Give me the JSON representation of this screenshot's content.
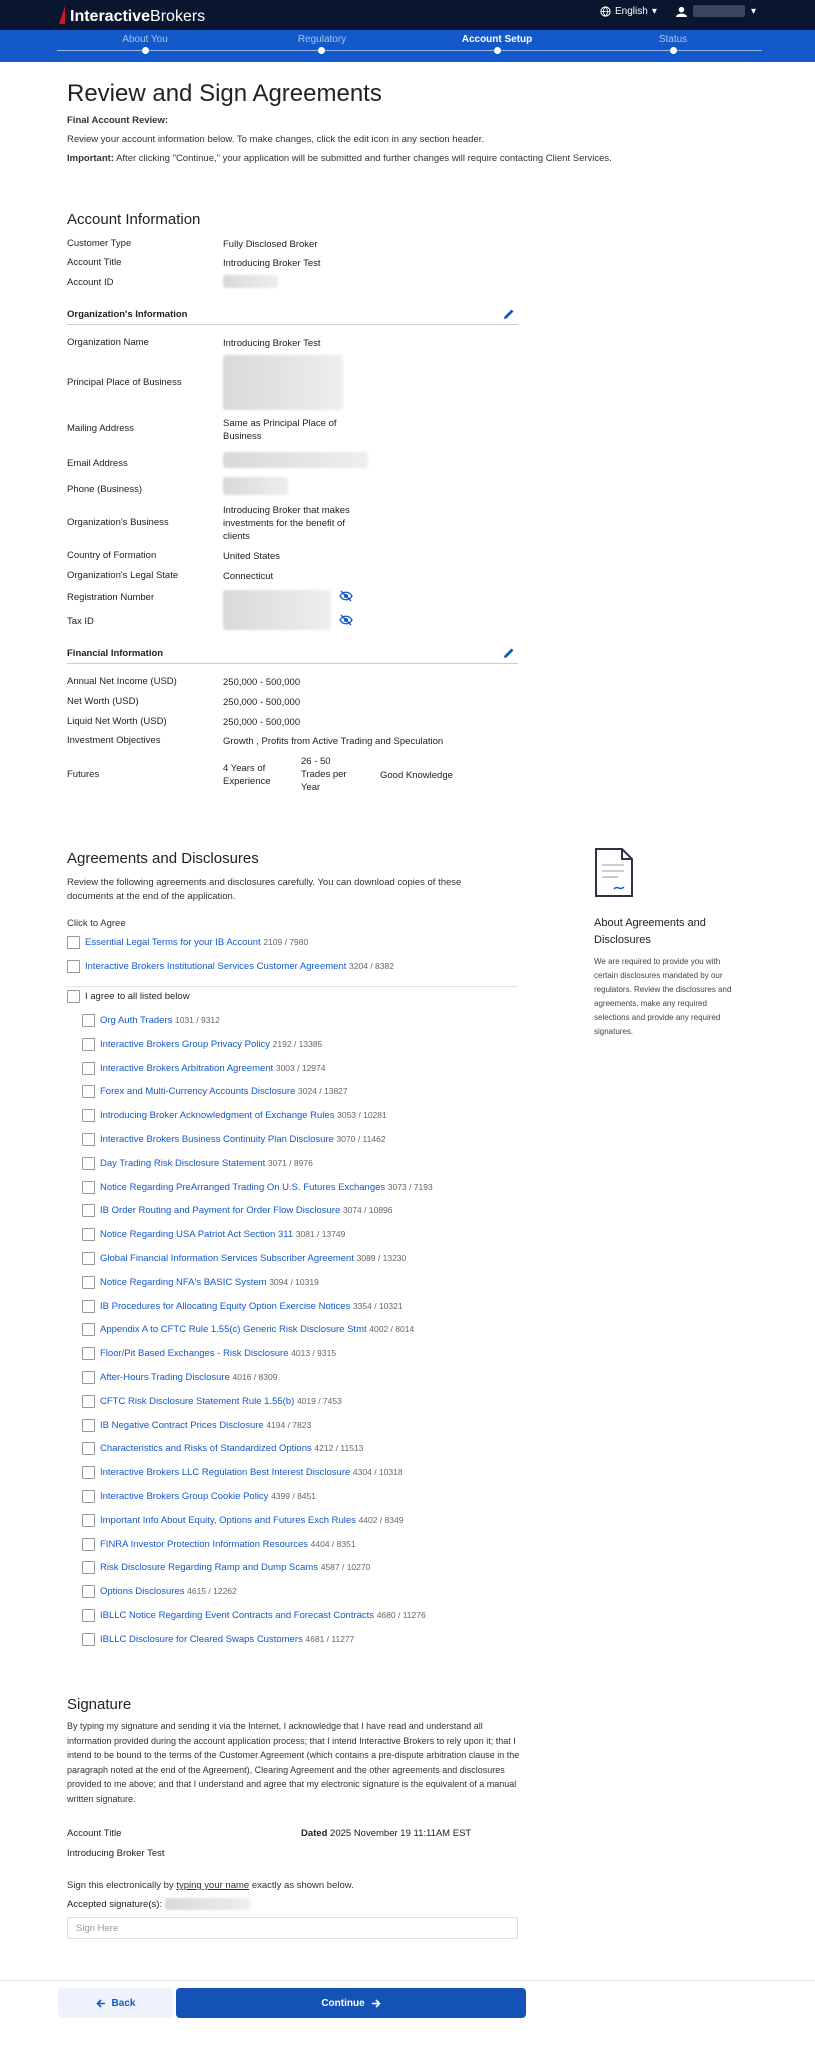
{
  "header": {
    "brand_bold": "Interactive",
    "brand_light": "Brokers",
    "language": "English",
    "language_caret": "▾",
    "user_caret": "▾"
  },
  "steps": [
    {
      "label": "About You",
      "active": false
    },
    {
      "label": "Regulatory",
      "active": false
    },
    {
      "label": "Account Setup",
      "active": true
    },
    {
      "label": "Status",
      "active": false
    }
  ],
  "page": {
    "title": "Review and Sign Agreements",
    "final_review": "Final Account Review:",
    "review_text": "Review your account information below. To make changes, click the edit icon in any section header.",
    "important_label": "Important:",
    "important_text": " After clicking \"Continue,\" your application will be submitted and further changes will require contacting Client Services."
  },
  "account_info": {
    "heading": "Account Information",
    "rows": [
      {
        "label": "Customer Type",
        "value": "Fully Disclosed Broker"
      },
      {
        "label": "Account Title",
        "value": "Introducing Broker Test"
      },
      {
        "label": "Account ID",
        "value": ""
      }
    ]
  },
  "org_info": {
    "heading": "Organization's Information",
    "rows": [
      {
        "label": "Organization Name",
        "value": "Introducing Broker Test"
      },
      {
        "label": "Principal Place of Business",
        "value": ""
      },
      {
        "label": "Mailing Address",
        "value": "Same as Principal Place of Business"
      },
      {
        "label": "Email Address",
        "value": ""
      },
      {
        "label": "Phone (Business)",
        "value": ""
      },
      {
        "label": "Organization's Business",
        "value": "Introducing Broker that makes investments for the benefit of clients"
      },
      {
        "label": "Country of Formation",
        "value": "United States"
      },
      {
        "label": "Organization's Legal State",
        "value": "Connecticut"
      },
      {
        "label": "Registration Number",
        "value": ""
      },
      {
        "label": "Tax ID",
        "value": ""
      }
    ]
  },
  "financial_info": {
    "heading": "Financial Information",
    "rows": [
      {
        "label": "Annual Net Income (USD)",
        "value": "250,000 - 500,000"
      },
      {
        "label": "Net Worth (USD)",
        "value": "250,000 - 500,000"
      },
      {
        "label": "Liquid Net Worth (USD)",
        "value": "250,000 - 500,000"
      },
      {
        "label": "Investment Objectives",
        "value": "Growth , Profits from Active Trading and Speculation"
      }
    ],
    "futures_label": "Futures",
    "futures_experience": "4 Years of Experience",
    "futures_trades": "26 - 50 Trades per Year",
    "futures_knowledge": "Good Knowledge"
  },
  "agreements": {
    "heading": "Agreements and Disclosures",
    "intro": "Review the following agreements and disclosures carefully. You can download copies of these documents at the end of the application.",
    "click_to_agree": "Click to Agree",
    "top_items": [
      {
        "title": "Essential Legal Terms for your IB Account",
        "ver": "2109 / 7980"
      },
      {
        "title": "Interactive Brokers Institutional Services Customer Agreement",
        "ver": "3204 / 8382"
      }
    ],
    "agree_all": "I agree to all listed below",
    "items": [
      {
        "title": "Org Auth Traders",
        "ver": "1031 / 9312"
      },
      {
        "title": "Interactive Brokers Group Privacy Policy",
        "ver": "2192 / 13385"
      },
      {
        "title": "Interactive Brokers Arbitration Agreement",
        "ver": "3003 / 12974"
      },
      {
        "title": "Forex and Multi-Currency Accounts Disclosure",
        "ver": "3024 / 13827"
      },
      {
        "title": "Introducing Broker Acknowledgment of Exchange Rules",
        "ver": "3053 / 10281"
      },
      {
        "title": "Interactive Brokers Business Continuity Plan Disclosure",
        "ver": "3070 / 11462"
      },
      {
        "title": "Day Trading Risk Disclosure Statement",
        "ver": "3071 / 8976"
      },
      {
        "title": "Notice Regarding PreArranged Trading On U.S. Futures  Exchanges",
        "ver": "3073 / 7193"
      },
      {
        "title": "IB Order Routing and Payment for Order Flow Disclosure",
        "ver": "3074 / 10896"
      },
      {
        "title": "Notice Regarding USA Patriot Act Section 311",
        "ver": "3081 / 13749"
      },
      {
        "title": "Global Financial Information Services Subscriber Agreement",
        "ver": "3089 / 13230"
      },
      {
        "title": "Notice Regarding NFA's BASIC System",
        "ver": "3094 / 10319"
      },
      {
        "title": "IB Procedures for Allocating Equity Option Exercise Notices",
        "ver": "3354 / 10321"
      },
      {
        "title": "Appendix A to CFTC Rule 1.55(c)  Generic Risk Disclosure Stmt",
        "ver": "4002 / 8014"
      },
      {
        "title": "Floor/Pit Based Exchanges - Risk Disclosure",
        "ver": "4013 / 9315"
      },
      {
        "title": "After-Hours Trading Disclosure",
        "ver": "4016 / 8309"
      },
      {
        "title": "CFTC Risk Disclosure Statement Rule 1.55(b)",
        "ver": "4019 / 7453"
      },
      {
        "title": "IB Negative Contract Prices Disclosure",
        "ver": "4194 / 7823"
      },
      {
        "title": "Characteristics and Risks of Standardized Options",
        "ver": "4212 / 11513"
      },
      {
        "title": "Interactive Brokers LLC Regulation Best Interest Disclosure",
        "ver": "4304 / 10318"
      },
      {
        "title": "Interactive Brokers Group Cookie Policy",
        "ver": "4399 / 8451"
      },
      {
        "title": "Important Info About Equity, Options and Futures Exch Rules",
        "ver": "4402 / 8349"
      },
      {
        "title": "FINRA Investor Protection Information Resources",
        "ver": "4404 / 8351"
      },
      {
        "title": "Risk Disclosure Regarding Ramp and Dump Scams",
        "ver": "4587 / 10270"
      },
      {
        "title": "Options Disclosures",
        "ver": "4615 / 12262"
      },
      {
        "title": "IBLLC Notice Regarding Event Contracts and Forecast Contracts",
        "ver": "4680 / 11276"
      },
      {
        "title": "IBLLC Disclosure for Cleared Swaps Customers",
        "ver": "4681 / 11277"
      }
    ]
  },
  "aside": {
    "title": "About Agreements and Disclosures",
    "text": "We are required to provide you with certain disclosures mandated by our regulators. Review the disclosures and agreements, make any required selections and provide any required signatures."
  },
  "signature": {
    "heading": "Signature",
    "body": "By typing my signature and sending it via the Internet, I acknowledge that I have read and understand all information provided during the account application process; that I intend Interactive Brokers to rely upon it; that I intend to be bound to the terms of the Customer Agreement (which contains a pre-dispute arbitration clause in the paragraph noted at the end of the Agreement), Clearing Agreement and the other agreements and disclosures provided to me above; and that I understand and agree that my electronic signature is the equivalent of a manual written signature.",
    "account_title_label": "Account Title",
    "account_title_value": "Introducing Broker Test",
    "dated_label": "Dated",
    "dated_value": "2025 November 19 11:11AM EST",
    "sign_pre": "Sign this electronically by ",
    "sign_link": "typing your name",
    "sign_post": " exactly as shown below.",
    "accepted_label": "Accepted signature(s):",
    "placeholder": "Sign Here"
  },
  "footer": {
    "back": "Back",
    "continue": "Continue"
  },
  "colors": {
    "topbar": "#0a1630",
    "stepbar": "#1459c9",
    "link": "#1459c9",
    "continue": "#1452b8"
  }
}
